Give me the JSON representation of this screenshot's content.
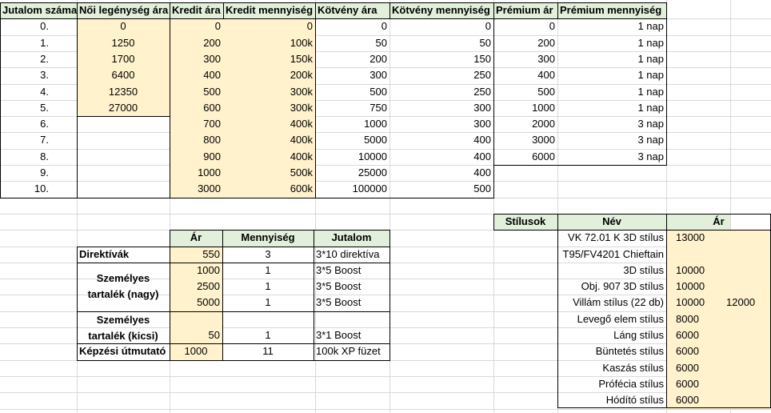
{
  "colors": {
    "header_fill": "#e2efda",
    "value_fill": "#fff2cc",
    "grid": "#d9d9d9",
    "border": "#000000"
  },
  "reward_table": {
    "headers": [
      "Jutalom száma",
      "Női legénység ára",
      "Kredit ára",
      "Kredit mennyiség",
      "Kötvény ára",
      "Kötvény mennyiség",
      "Prémium ár",
      "Prémium mennyiség"
    ],
    "rows": [
      [
        "0.",
        "0",
        "0",
        "0",
        "0",
        "0",
        "0",
        "1 nap"
      ],
      [
        "1.",
        "1250",
        "200",
        "100k",
        "50",
        "50",
        "200",
        "1 nap"
      ],
      [
        "2.",
        "1700",
        "300",
        "150k",
        "200",
        "150",
        "300",
        "1 nap"
      ],
      [
        "3.",
        "6400",
        "400",
        "200k",
        "300",
        "250",
        "400",
        "1 nap"
      ],
      [
        "4.",
        "12350",
        "500",
        "300k",
        "500",
        "250",
        "500",
        "1 nap"
      ],
      [
        "5.",
        "27000",
        "600",
        "300k",
        "750",
        "300",
        "1000",
        "1 nap"
      ],
      [
        "6.",
        "",
        "700",
        "400k",
        "1000",
        "300",
        "2000",
        "3 nap"
      ],
      [
        "7.",
        "",
        "800",
        "400k",
        "5000",
        "400",
        "3000",
        "3 nap"
      ],
      [
        "8.",
        "",
        "900",
        "400k",
        "10000",
        "400",
        "6000",
        "3 nap"
      ],
      [
        "9.",
        "",
        "1000",
        "500k",
        "25000",
        "400",
        "",
        ""
      ],
      [
        "10.",
        "",
        "3000",
        "600k",
        "100000",
        "500",
        "",
        ""
      ]
    ]
  },
  "shop_table": {
    "headers": [
      "Ár",
      "Mennyiség",
      "Jutalom"
    ],
    "directives": {
      "label": "Direktívák",
      "price": "550",
      "qty": "3",
      "reward": "3*10 direktíva"
    },
    "large_reserve": {
      "label_line1": "Személyes",
      "label_line2": "tartalék (nagy)",
      "rows": [
        {
          "price": "1000",
          "qty": "1",
          "reward": "3*5 Boost"
        },
        {
          "price": "2500",
          "qty": "1",
          "reward": "3*5 Boost"
        },
        {
          "price": "5000",
          "qty": "1",
          "reward": "3*5 Boost"
        }
      ]
    },
    "small_reserve": {
      "label_line1": "Személyes",
      "label_line2": "tartalék (kicsi)",
      "price": "50",
      "qty": "1",
      "reward": "3*1 Boost"
    },
    "training": {
      "label": "Képzési útmutató",
      "price": "1000",
      "qty": "11",
      "reward": "100k XP füzet"
    }
  },
  "styles_table": {
    "label": "Stílusok",
    "headers": [
      "Név",
      "Ár"
    ],
    "rows": [
      {
        "name": "VK 72.01 K 3D stílus",
        "price": "13000",
        "extra": ""
      },
      {
        "name": "T95/FV4201 Chieftain",
        "price": "",
        "extra": ""
      },
      {
        "name": "3D stílus",
        "price": "10000",
        "extra": ""
      },
      {
        "name": "Obj. 907 3D stílus",
        "price": "10000",
        "extra": ""
      },
      {
        "name": "Villám stílus (22 db)",
        "price": "10000",
        "extra": "12000"
      },
      {
        "name": "Levegő elem stílus",
        "price": "8000",
        "extra": ""
      },
      {
        "name": "Láng stílus",
        "price": "6000",
        "extra": ""
      },
      {
        "name": "Büntetés stílus",
        "price": "6000",
        "extra": ""
      },
      {
        "name": "Kaszás stílus",
        "price": "6000",
        "extra": ""
      },
      {
        "name": "Prófécia stílus",
        "price": "6000",
        "extra": ""
      },
      {
        "name": "Hódító stílus",
        "price": "6000",
        "extra": ""
      }
    ]
  }
}
